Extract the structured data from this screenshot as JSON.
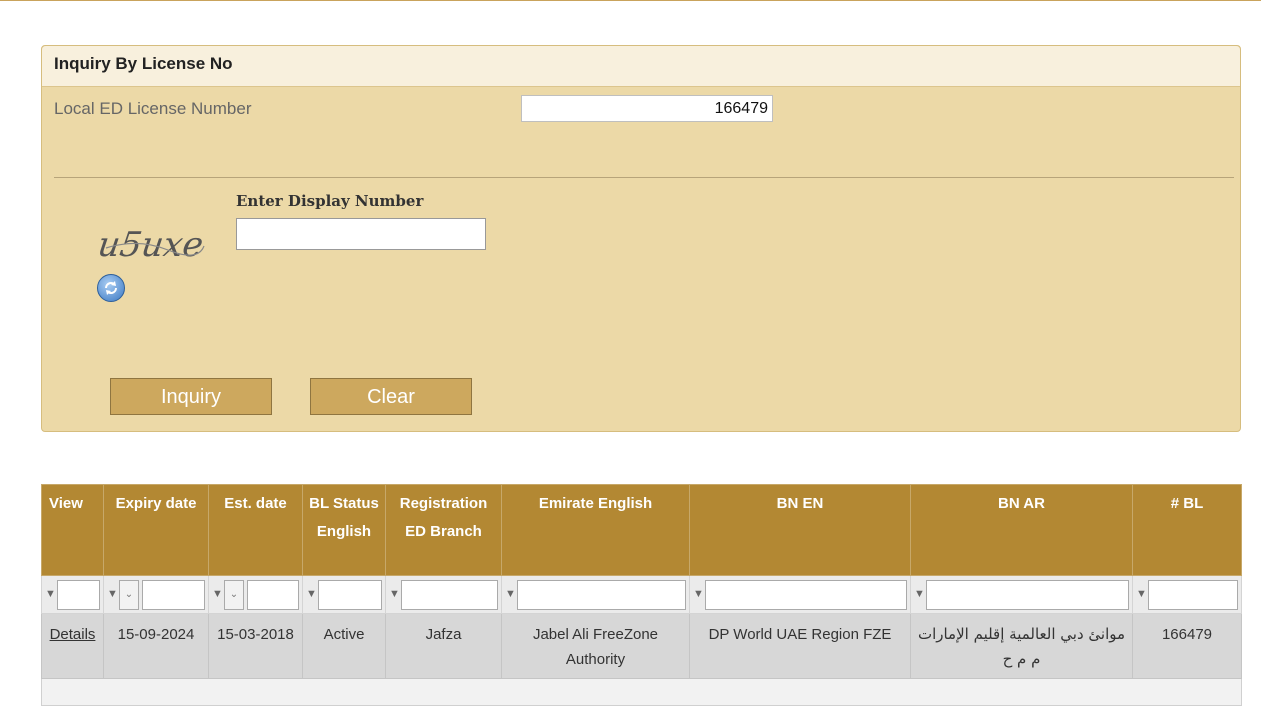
{
  "panel": {
    "title": "Inquiry By License No",
    "license_label": "Local ED License Number",
    "license_value": "166479",
    "captcha_label": "Enter Display Number",
    "captcha_text": "u5uxe",
    "captcha_input_value": "",
    "inquiry_label": "Inquiry",
    "clear_label": "Clear"
  },
  "grid": {
    "headers": [
      "View",
      "Expiry date",
      "Est. date",
      "BL Status English",
      "Registration ED Branch",
      "Emirate English",
      "BN EN",
      "BN AR",
      "# BL"
    ],
    "rows": [
      {
        "view": "Details",
        "expiry": "15-09-2024",
        "est": "15-03-2018",
        "status": "Active",
        "branch": "Jafza",
        "emirate": "Jabel Ali FreeZone Authority",
        "bn_en": "DP World UAE Region FZE",
        "bn_ar": "موانئ دبي العالمية إقليم الإمارات م م ح",
        "bl": "166479"
      }
    ]
  },
  "colors": {
    "panel_bg": "#ecd9a7",
    "header_bg": "#b38833",
    "button_bg": "#cda85e"
  }
}
